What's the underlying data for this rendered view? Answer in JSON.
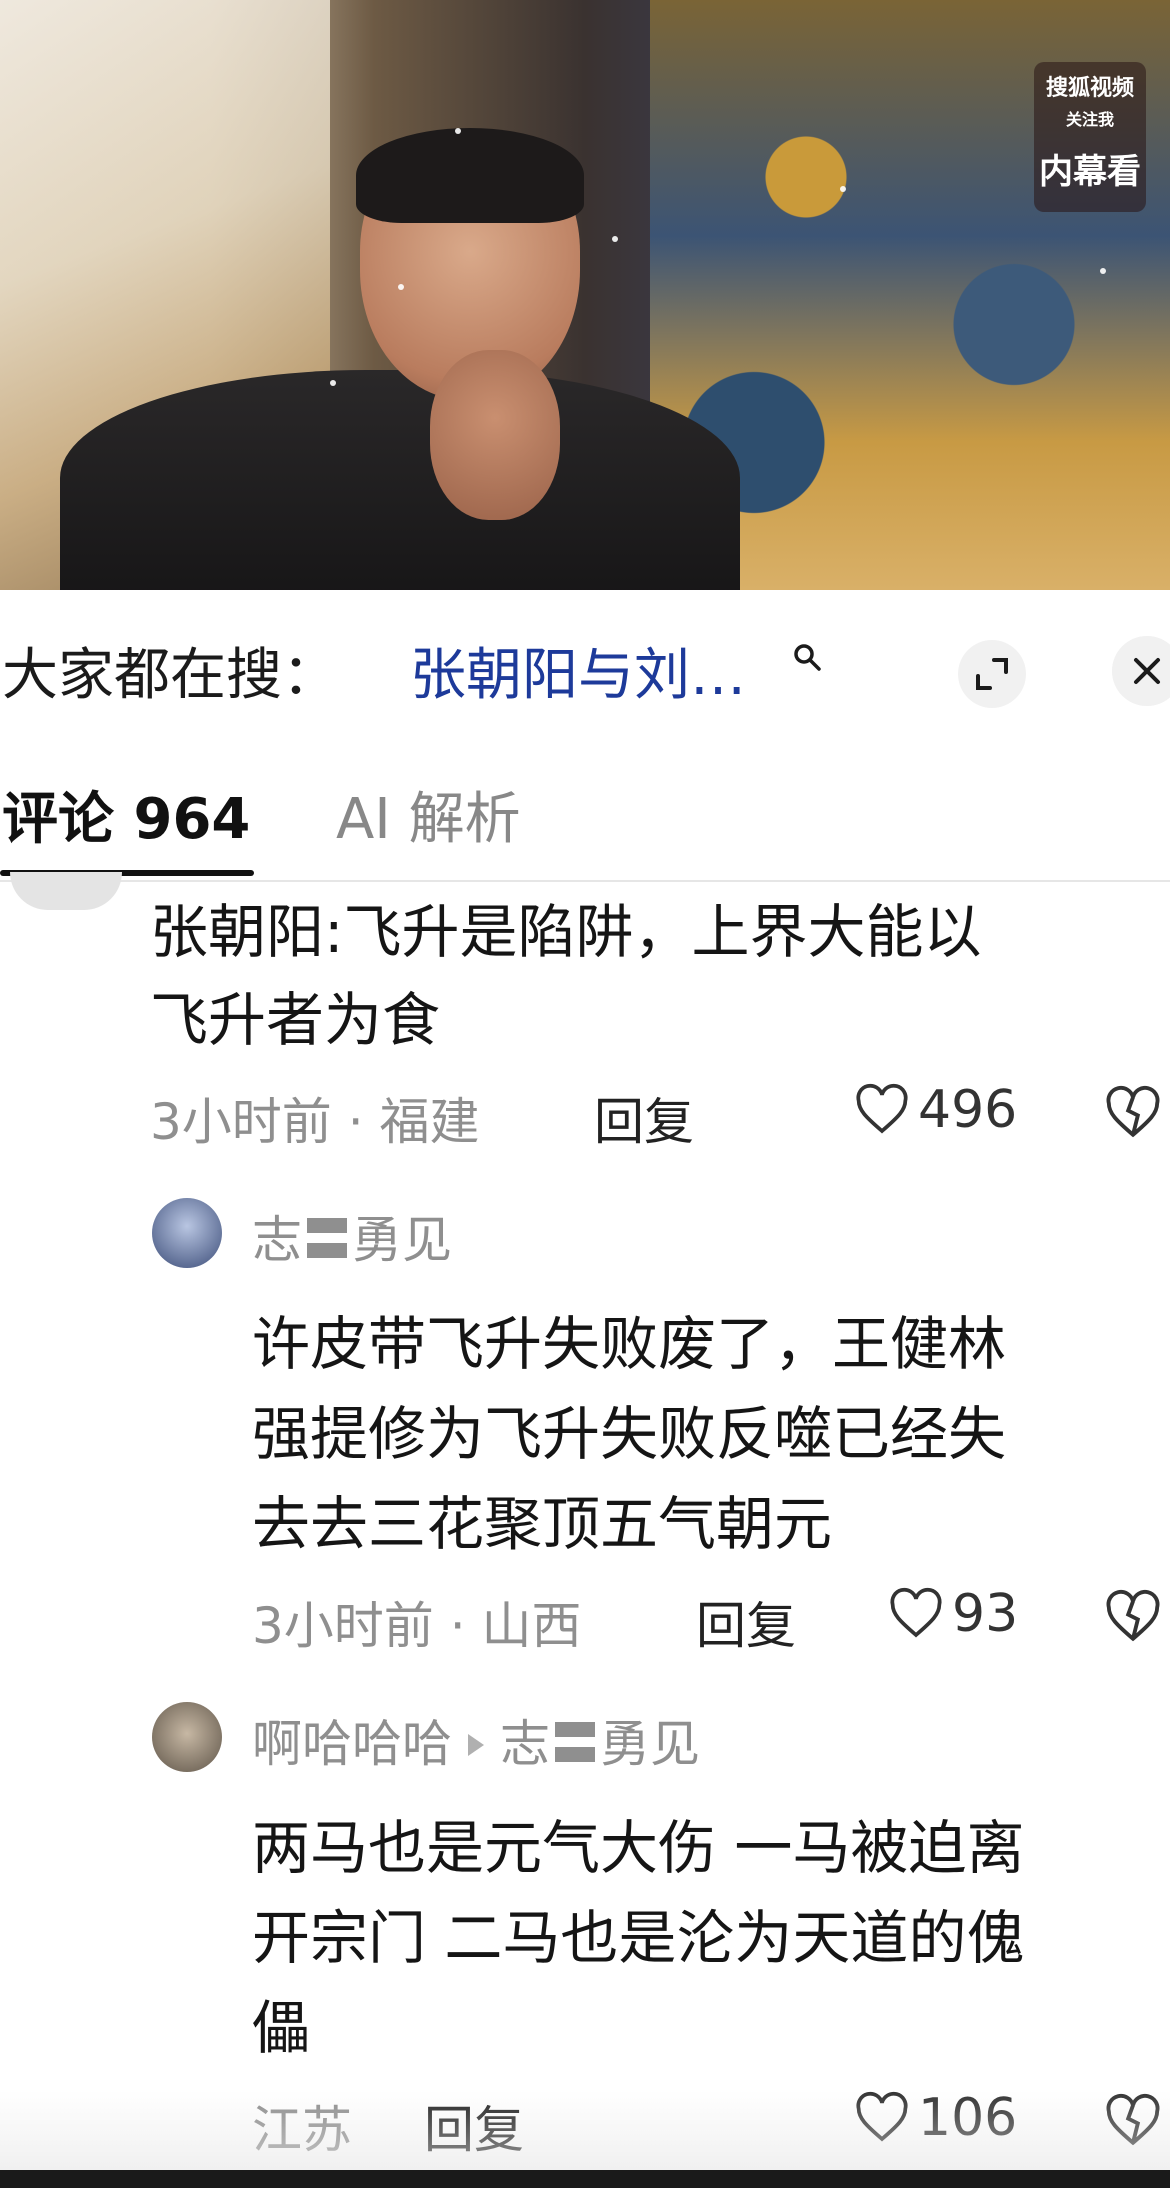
{
  "video": {
    "badge_line1": "搜狐视频",
    "badge_line2": "关注我",
    "badge_line3": "内幕看"
  },
  "search": {
    "prefix": "大家都在搜：",
    "term": "张朝阳与刘…"
  },
  "tabs": {
    "comments_label": "评论 964",
    "ai_label": "AI 解析"
  },
  "comments": [
    {
      "lines": [
        "张朝阳:飞升是陷阱，上界大能以",
        "飞升者为食"
      ],
      "meta": "3小时前 · 福建",
      "reply": "回复",
      "likes": "496"
    },
    {
      "author": "志〓勇见",
      "lines": [
        "许皮带飞升失败废了，王健林",
        "强提修为飞升失败反噬已经失",
        "去去三花聚顶五气朝元"
      ],
      "meta": "3小时前 · 山西",
      "reply": "回复",
      "likes": "93"
    },
    {
      "author": "啊哈哈哈",
      "reply_to": "志〓勇见",
      "lines": [
        "两马也是元气大伤 一马被迫离",
        "开宗门  二马也是沦为天道的傀",
        "儡"
      ],
      "meta": "江苏",
      "reply": "回复",
      "likes": "106"
    }
  ]
}
